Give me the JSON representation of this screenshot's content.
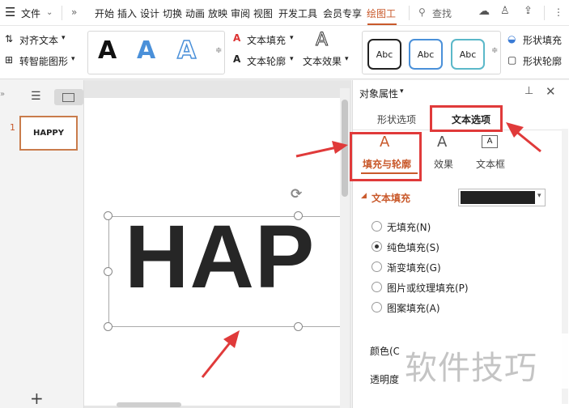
{
  "menubar": {
    "file_label": "文件",
    "more_label": "»",
    "tabs": [
      "开始",
      "插入",
      "设计",
      "切换",
      "动画",
      "放映",
      "审阅",
      "视图",
      "开发工具",
      "会员专享",
      "绘图工"
    ],
    "search_label": "查找",
    "more_menu": "⋮"
  },
  "toolbar": {
    "align_text": "对齐文本",
    "smart_shape": "转智能图形",
    "art_letter": "A",
    "abc_label": "Abc",
    "text_fill": "文本填充",
    "text_outline": "文本轮廓",
    "text_effect": "文本效果",
    "shape_fill": "形状填充",
    "shape_outline": "形状轮廓"
  },
  "thumbnails": {
    "slide_number": "1",
    "slide_text": "HAPPY"
  },
  "slide": {
    "text": "HAP"
  },
  "panel": {
    "title": "对象属性",
    "tab_shape": "形状选项",
    "tab_text": "文本选项",
    "sub_fill_outline": "填充与轮廓",
    "sub_effect": "效果",
    "sub_textbox": "文本框",
    "section_title": "文本填充",
    "fill_color": "#222222",
    "options": [
      "无填充(N)",
      "纯色填充(S)",
      "渐变填充(G)",
      "图片或纹理填充(P)",
      "图案填充(A)"
    ],
    "selected_option": 1,
    "color_label": "颜色(C",
    "transparency_label": "透明度"
  },
  "watermark": "软件技巧",
  "colors": {
    "highlight": "#e03a3a",
    "accent": "#c9592b",
    "blue_a": "#4a90d9"
  }
}
